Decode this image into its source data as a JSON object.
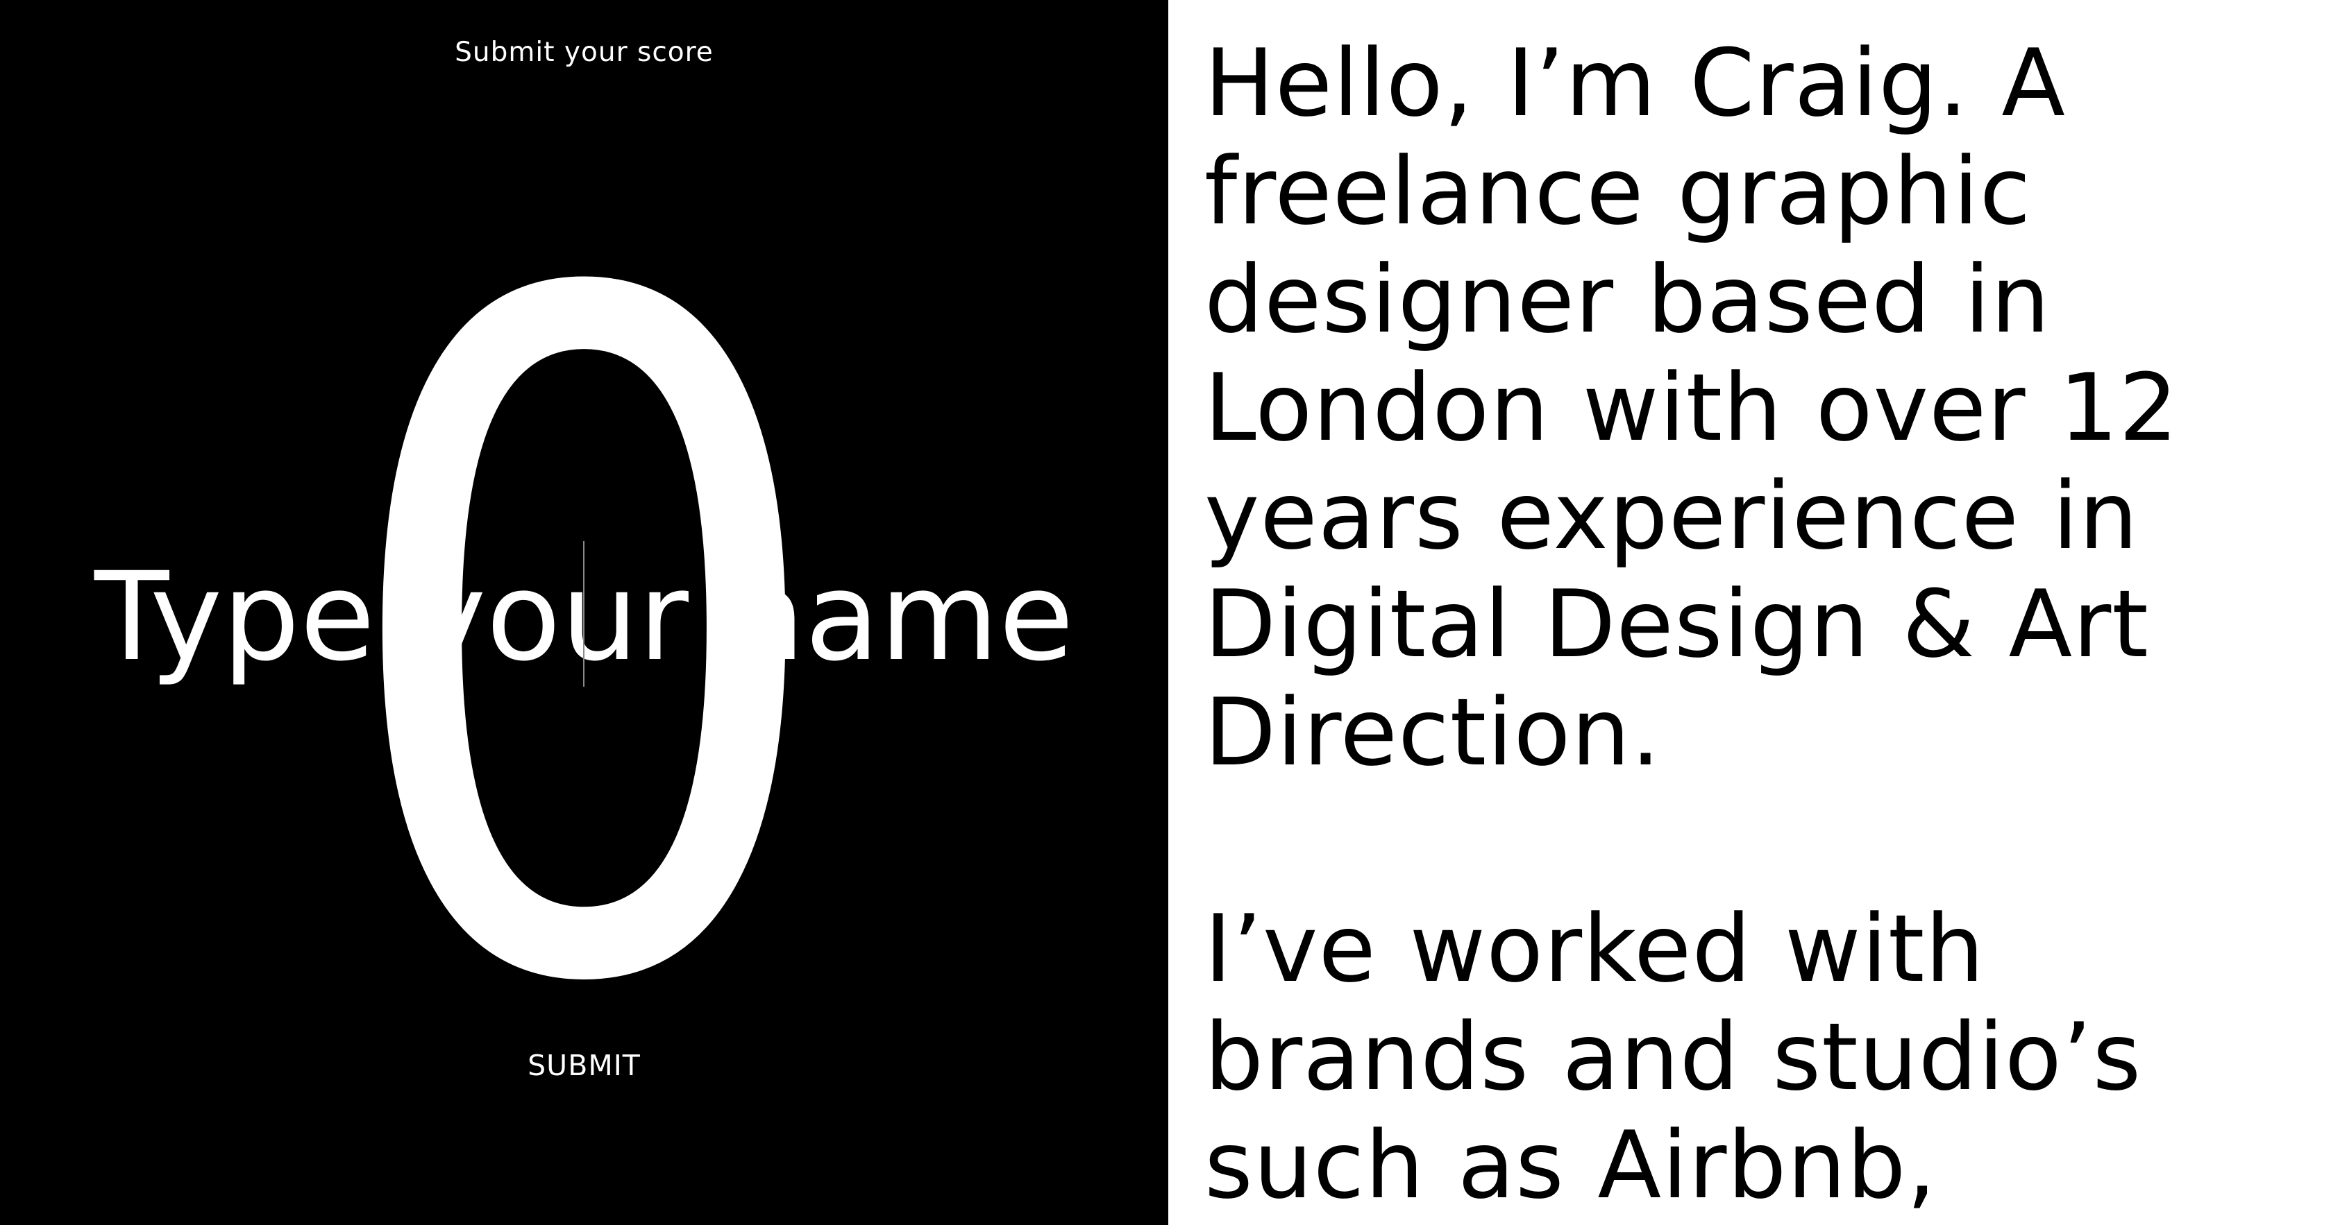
{
  "game": {
    "heading": "Submit your score",
    "score": "0",
    "name_placeholder": "Type your name",
    "submit_label": "SUBMIT"
  },
  "bio": {
    "paragraph_1": [
      "Hello, I’m Craig. A",
      "freelance graphic",
      "designer based in",
      "London with over 12",
      "years experience in",
      "Digital Design & Art",
      "Direction."
    ],
    "paragraph_2": [
      "I’ve worked with",
      "brands and studio’s",
      "such as Airbnb,"
    ]
  },
  "colors": {
    "game_background": "#000000",
    "game_text": "#ffffff",
    "bio_background": "#ffffff",
    "bio_text": "#000000"
  }
}
